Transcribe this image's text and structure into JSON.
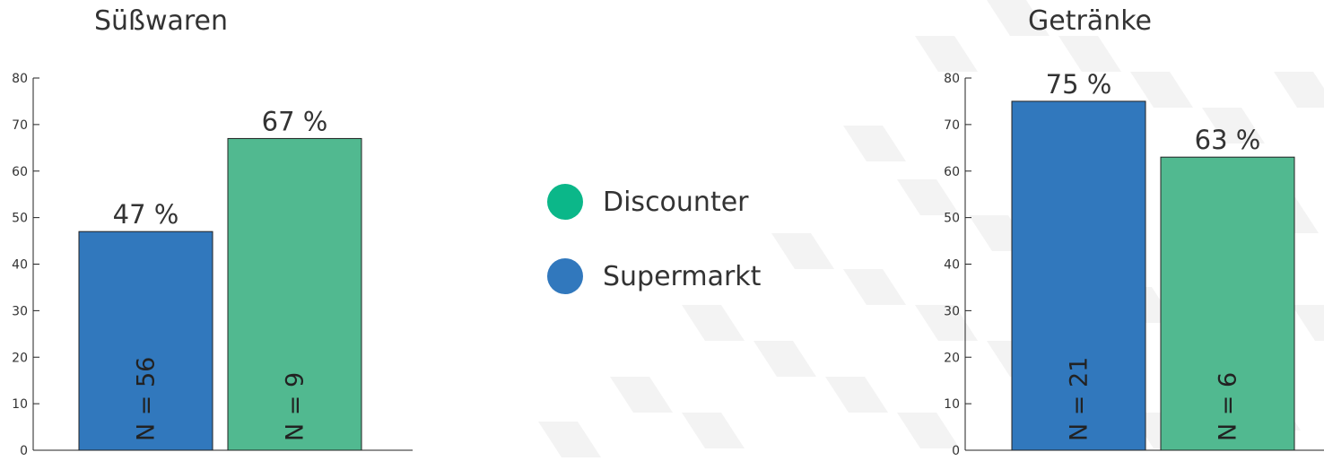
{
  "colors": {
    "supermarkt": "#3178bd",
    "discounter": "#51b990",
    "discounter_legend": "#0bb789",
    "axis": "#222222",
    "text": "#333333"
  },
  "legend": {
    "items": [
      {
        "label": "Discounter",
        "color": "#0bb789"
      },
      {
        "label": "Supermarkt",
        "color": "#3178bd"
      }
    ]
  },
  "chart_data": [
    {
      "type": "bar",
      "title": "Süßwaren",
      "categories": [
        "Supermarkt",
        "Discounter"
      ],
      "values": [
        47,
        67
      ],
      "value_labels": [
        "47 %",
        "67 %"
      ],
      "n_labels": [
        "N = 56",
        "N = 9"
      ],
      "ylim": [
        0,
        80
      ],
      "yticks": [
        "0",
        "10",
        "20",
        "30",
        "40",
        "50",
        "60",
        "70",
        "80"
      ],
      "colors": [
        "#3178bd",
        "#51b990"
      ]
    },
    {
      "type": "bar",
      "title": "Getränke",
      "categories": [
        "Supermarkt",
        "Discounter"
      ],
      "values": [
        75,
        63
      ],
      "value_labels": [
        "75 %",
        "63 %"
      ],
      "n_labels": [
        "N = 21",
        "N = 6"
      ],
      "ylim": [
        0,
        80
      ],
      "yticks": [
        "0",
        "10",
        "20",
        "30",
        "40",
        "50",
        "60",
        "70",
        "80"
      ],
      "colors": [
        "#3178bd",
        "#51b990"
      ]
    }
  ]
}
